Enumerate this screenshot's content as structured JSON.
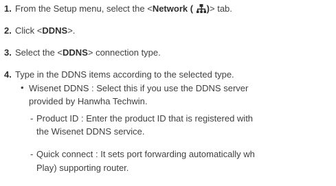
{
  "steps": [
    {
      "number": "1.",
      "pre": "From the Setup menu, select the <",
      "bold": "Network (",
      "icon": "network-icon",
      "bold_close": ")",
      "post": "> tab."
    },
    {
      "number": "2.",
      "pre": "Click <",
      "bold": "DDNS",
      "post": ">."
    },
    {
      "number": "3.",
      "pre": "Select the <",
      "bold": "DDNS",
      "post": "> connection type."
    },
    {
      "number": "4.",
      "text": "Type in the DDNS items according to the selected type."
    }
  ],
  "bullet": {
    "line1": "Wisenet DDNS : Select this if you use the DDNS server",
    "line2": "provided by Hanwha Techwin."
  },
  "subitems": [
    {
      "line1": "Product ID : Enter the product ID that is registered with",
      "line2": "the Wisenet DDNS service."
    },
    {
      "line1": "Quick connect : It sets port forwarding automatically wh",
      "line2": "Play) supporting router."
    }
  ]
}
